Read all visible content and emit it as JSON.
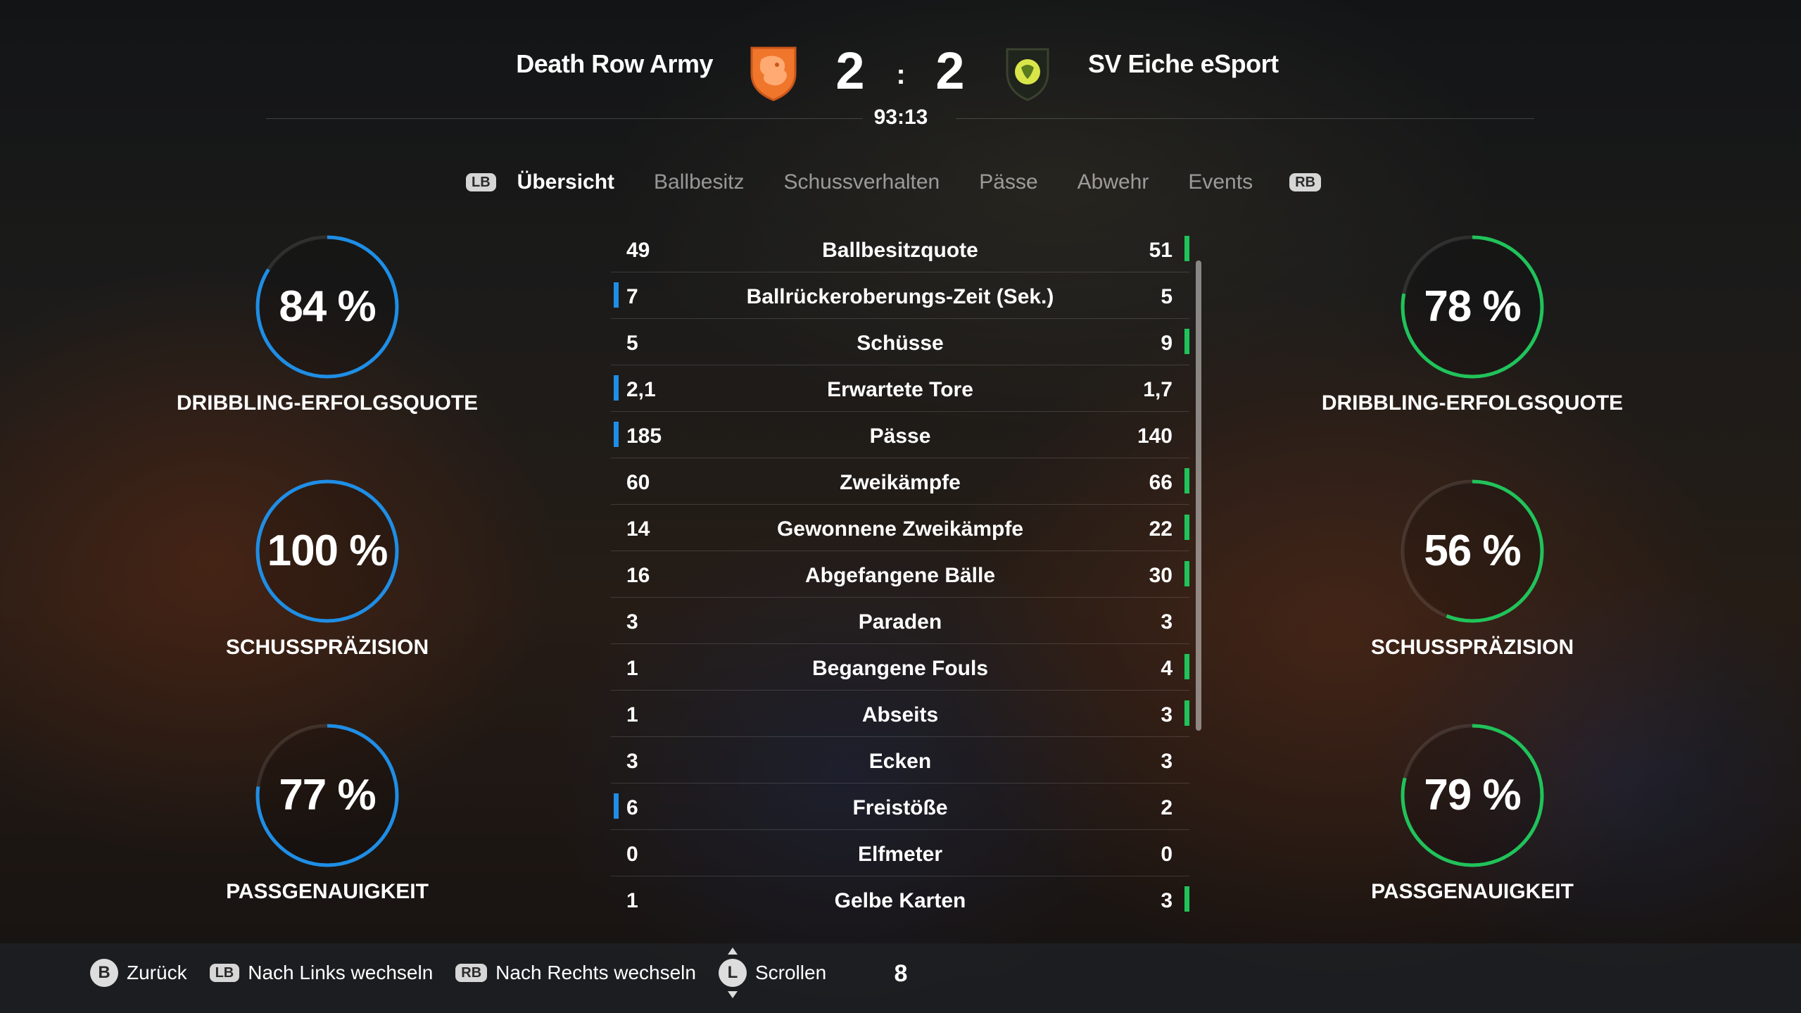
{
  "match": {
    "home_team": "Death Row Army",
    "away_team": "SV Eiche eSport",
    "home_score": "2",
    "away_score": "2",
    "separator": ":",
    "clock": "93:13",
    "home_crest_icon": "lion-crest-icon",
    "away_crest_icon": "oak-shield-crest-icon"
  },
  "tabs": {
    "lb": "LB",
    "rb": "RB",
    "items": [
      "Übersicht",
      "Ballbesitz",
      "Schussverhalten",
      "Pässe",
      "Abwehr",
      "Events"
    ],
    "active": "Übersicht"
  },
  "colors": {
    "home_accent": "#1e8ee6",
    "away_accent": "#20c35a"
  },
  "home_rings": [
    {
      "value_text": "84 %",
      "value": 84,
      "label": "DRIBBLING-ERFOLGSQUOTE"
    },
    {
      "value_text": "100 %",
      "value": 100,
      "label": "SCHUSSPRÄZISION"
    },
    {
      "value_text": "77 %",
      "value": 77,
      "label": "PASSGENAUIGKEIT"
    }
  ],
  "away_rings": [
    {
      "value_text": "78 %",
      "value": 78,
      "label": "DRIBBLING-ERFOLGSQUOTE"
    },
    {
      "value_text": "56 %",
      "value": 56,
      "label": "SCHUSSPRÄZISION"
    },
    {
      "value_text": "79 %",
      "value": 79,
      "label": "PASSGENAUIGKEIT"
    }
  ],
  "stats": [
    {
      "home": "49",
      "label": "Ballbesitzquote",
      "away": "51",
      "leader": "away"
    },
    {
      "home": "7",
      "label": "Ballrückeroberungs-Zeit (Sek.)",
      "away": "5",
      "leader": "home"
    },
    {
      "home": "5",
      "label": "Schüsse",
      "away": "9",
      "leader": "away"
    },
    {
      "home": "2,1",
      "label": "Erwartete Tore",
      "away": "1,7",
      "leader": "home"
    },
    {
      "home": "185",
      "label": "Pässe",
      "away": "140",
      "leader": "home"
    },
    {
      "home": "60",
      "label": "Zweikämpfe",
      "away": "66",
      "leader": "away"
    },
    {
      "home": "14",
      "label": "Gewonnene Zweikämpfe",
      "away": "22",
      "leader": "away"
    },
    {
      "home": "16",
      "label": "Abgefangene Bälle",
      "away": "30",
      "leader": "away"
    },
    {
      "home": "3",
      "label": "Paraden",
      "away": "3",
      "leader": "none"
    },
    {
      "home": "1",
      "label": "Begangene Fouls",
      "away": "4",
      "leader": "away"
    },
    {
      "home": "1",
      "label": "Abseits",
      "away": "3",
      "leader": "away"
    },
    {
      "home": "3",
      "label": "Ecken",
      "away": "3",
      "leader": "none"
    },
    {
      "home": "6",
      "label": "Freistöße",
      "away": "2",
      "leader": "home"
    },
    {
      "home": "0",
      "label": "Elfmeter",
      "away": "0",
      "leader": "none"
    },
    {
      "home": "1",
      "label": "Gelbe Karten",
      "away": "3",
      "leader": "away"
    }
  ],
  "hints": {
    "back_button": "B",
    "back_label": "Zurück",
    "left_button": "LB",
    "left_label": "Nach Links wechseln",
    "right_button": "RB",
    "right_label": "Nach Rechts wechseln",
    "scroll_button": "L",
    "scroll_label": "Scrollen",
    "page_number": "8"
  }
}
